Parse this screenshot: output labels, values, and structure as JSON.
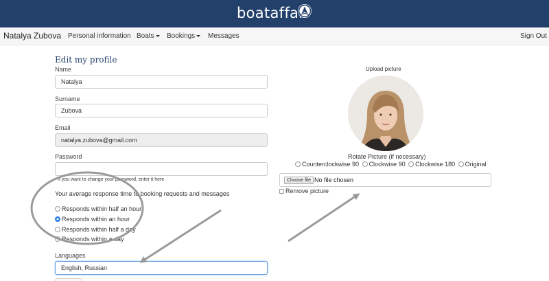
{
  "header": {
    "brand": "boataffair",
    "logo_icon": "boataffair-logo-icon",
    "background": "#23406b"
  },
  "navbar": {
    "user_name": "Natalya Zubova",
    "items": [
      {
        "label": "Personal information"
      },
      {
        "label": "Boats",
        "dropdown": true
      },
      {
        "label": "Bookings",
        "dropdown": true
      },
      {
        "label": "Messages"
      }
    ],
    "sign_out": "Sign Out"
  },
  "form": {
    "title": "Edit my profile",
    "name": {
      "label": "Name",
      "value": "Natalya"
    },
    "surname": {
      "label": "Surname",
      "value": "Zubova"
    },
    "email": {
      "label": "Email",
      "value": "natalya.zubova@gmail.com"
    },
    "password": {
      "label": "Password",
      "value": "",
      "help": "If you want to change your password, enter it here"
    },
    "response_time": {
      "question": "Your average response time to booking requests and messages",
      "options": [
        {
          "label": "Responds within half an hour",
          "checked": false
        },
        {
          "label": "Responds within an hour",
          "checked": true
        },
        {
          "label": "Responds within half a day",
          "checked": false
        },
        {
          "label": "Responds within a day",
          "checked": false
        }
      ]
    },
    "languages": {
      "label": "Languages",
      "value": "English, Russian"
    }
  },
  "upload": {
    "title": "Upload picture",
    "rotate_title": "Rotate Picture (if necessary)",
    "rotate_options": [
      "Counterclockwise 90",
      "Clockwise 90",
      "Clockwise 180",
      "Original"
    ],
    "file_button": "Choose file",
    "file_status": "No file chosen",
    "remove_label": "Remove picture"
  },
  "annotation_color": "#9a9a9a"
}
